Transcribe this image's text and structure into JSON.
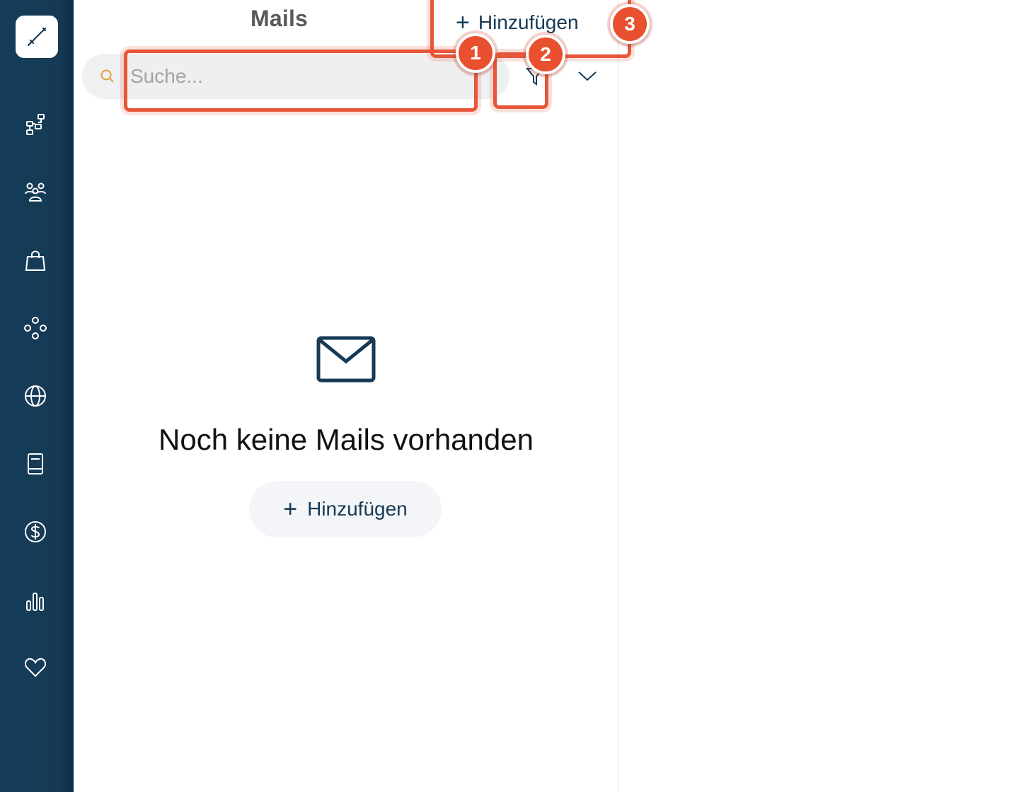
{
  "header": {
    "title": "Mails",
    "add_label": "Hinzufügen",
    "add_icon": "plus-icon"
  },
  "search": {
    "placeholder": "Suche...",
    "value": "",
    "icon": "search-icon"
  },
  "toolbar": {
    "filter_icon": "filter-icon",
    "dropdown_icon": "chevron-down-icon"
  },
  "sidebar": {
    "items": [
      {
        "icon": "logo-pen-icon"
      },
      {
        "icon": "sitemap-icon"
      },
      {
        "icon": "users-icon"
      },
      {
        "icon": "shopping-bag-icon"
      },
      {
        "icon": "network-icon"
      },
      {
        "icon": "globe-icon"
      },
      {
        "icon": "book-icon"
      },
      {
        "icon": "dollar-icon"
      },
      {
        "icon": "bar-chart-icon"
      },
      {
        "icon": "heart-icon"
      }
    ]
  },
  "empty_state": {
    "icon": "mail-icon",
    "message": "Noch keine Mails vorhanden",
    "add_label": "Hinzufügen"
  },
  "annotations": [
    {
      "number": "1",
      "target": "search-input"
    },
    {
      "number": "2",
      "target": "filter-button"
    },
    {
      "number": "3",
      "target": "header-add-button"
    }
  ],
  "colors": {
    "sidebar_bg": "#143d59",
    "accent_text": "#163a55",
    "annotation": "#e8563a",
    "search_bg": "#eef0f2"
  }
}
